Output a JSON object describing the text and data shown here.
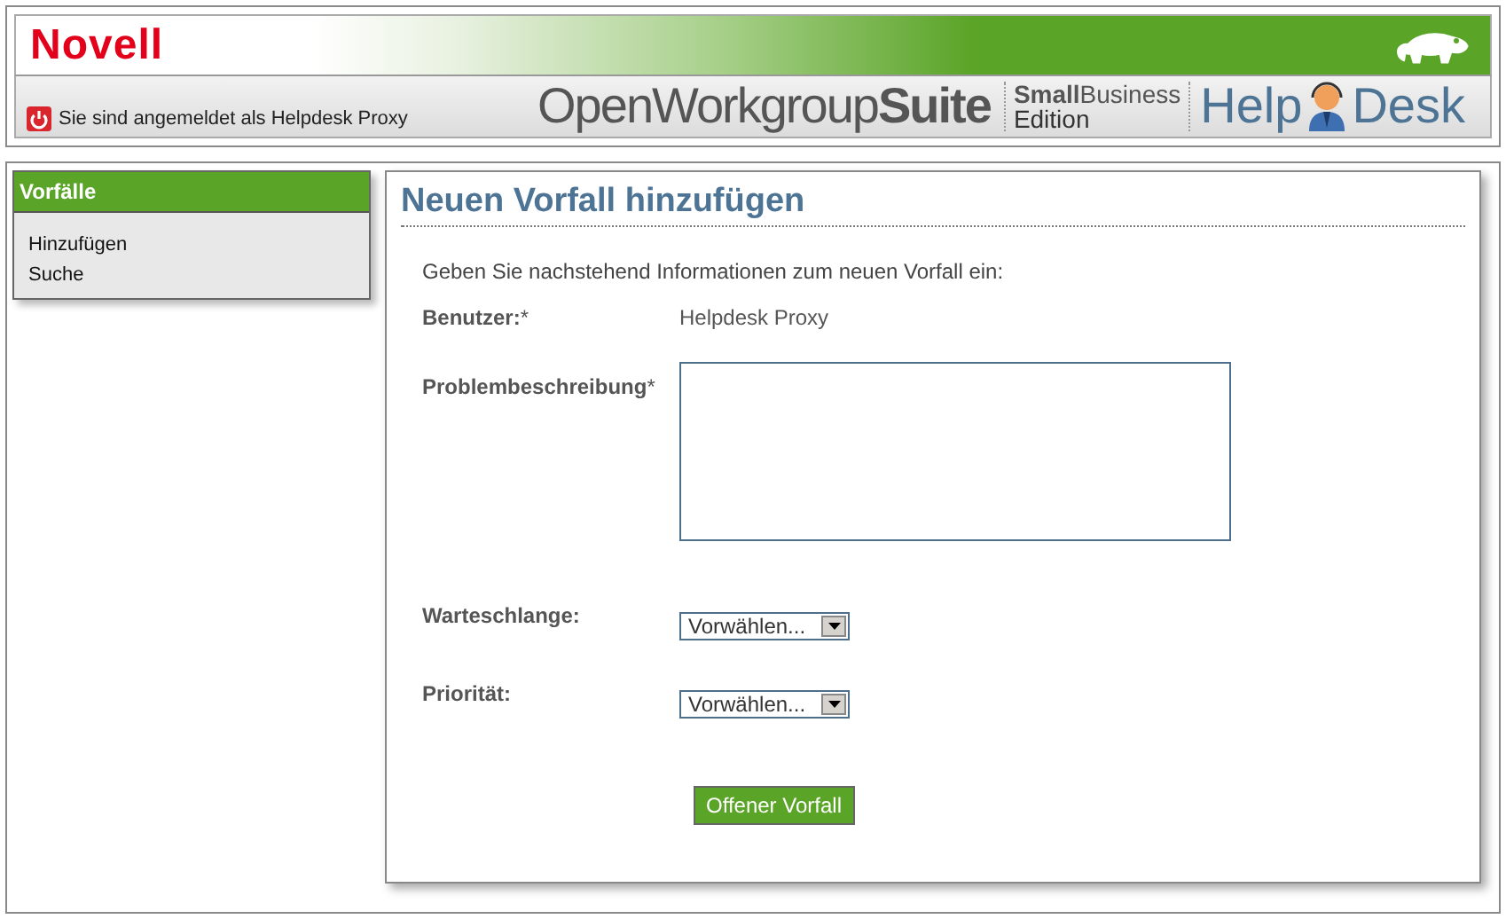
{
  "header": {
    "brand": "Novell",
    "login_text": "Sie sind angemeldet als Helpdesk Proxy",
    "suite": "OpenWorkgroup**Suite**",
    "edition_line1": "**Small**Business",
    "edition_line2": "Edition",
    "help": "Help",
    "desk": "Desk"
  },
  "sidebar": {
    "title": "Vorfälle",
    "items": [
      {
        "label": "Hinzufügen"
      },
      {
        "label": "Suche"
      }
    ]
  },
  "form": {
    "title": "Neuen Vorfall hinzufügen",
    "intro": "Geben Sie nachstehend Informationen zum neuen Vorfall ein:",
    "fields": [
      {
        "kind": "text",
        "label": "Benutzer:",
        "required_mark": "*",
        "value": "Helpdesk Proxy"
      },
      {
        "kind": "textarea",
        "label": "Problembeschreibung",
        "required_mark": "*"
      },
      {
        "kind": "select",
        "label": "Warteschlange:",
        "value": "Vorwählen..."
      },
      {
        "kind": "select",
        "label": "Priorität:",
        "value": "Vorwählen..."
      }
    ],
    "submit": "Offener Vorfall"
  }
}
